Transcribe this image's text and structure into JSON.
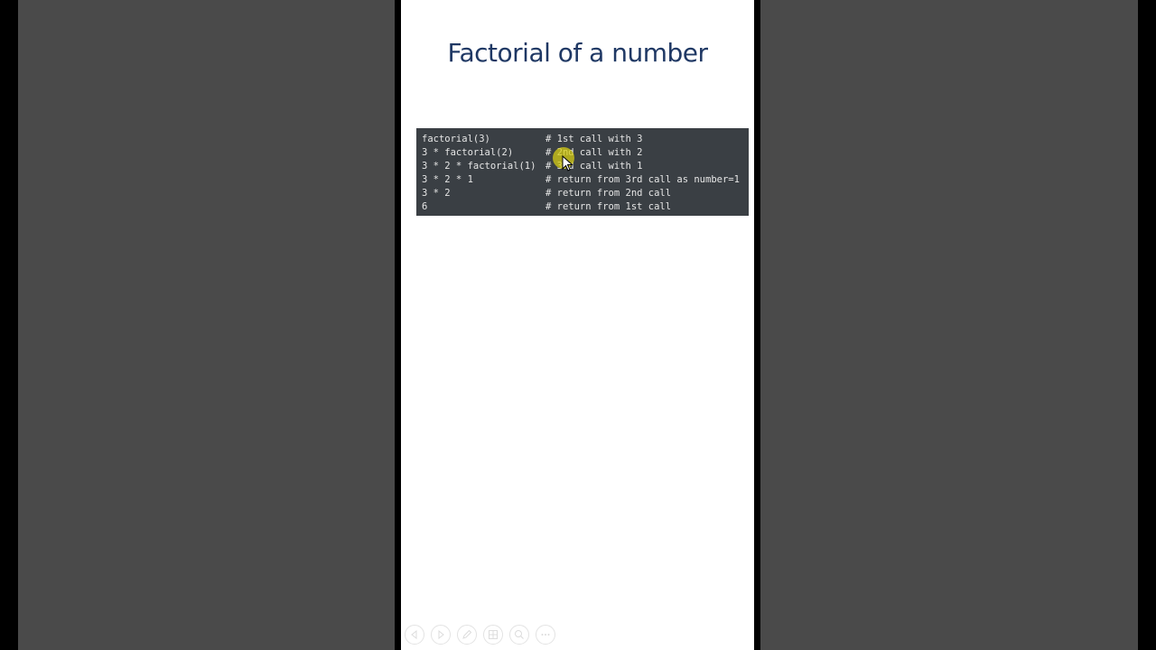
{
  "slide": {
    "title": "Factorial of a number"
  },
  "code_block": {
    "lines": [
      {
        "expr": "factorial(3)",
        "comment": "# 1st call with 3"
      },
      {
        "expr": "3 * factorial(2)",
        "comment": "# 2nd call with 2"
      },
      {
        "expr": "3 * 2 * factorial(1)",
        "comment": "# 3rd call with 1"
      },
      {
        "expr": "3 * 2 * 1",
        "comment": "# return from 3rd call as number=1"
      },
      {
        "expr": "3 * 2",
        "comment": "# return from 2nd call"
      },
      {
        "expr": "6",
        "comment": "# return from 1st call"
      }
    ]
  },
  "toolbar": {
    "buttons": [
      {
        "icon": "previous-icon"
      },
      {
        "icon": "next-icon"
      },
      {
        "icon": "pen-icon"
      },
      {
        "icon": "slides-grid-icon"
      },
      {
        "icon": "zoom-icon"
      },
      {
        "icon": "more-options-icon"
      }
    ]
  },
  "colors": {
    "title": "#1f3864",
    "code_background": "#3a3f44",
    "code_text": "#e6e6e6",
    "pointer_highlight": "#d7cd14",
    "background": "#4a4a4a"
  }
}
